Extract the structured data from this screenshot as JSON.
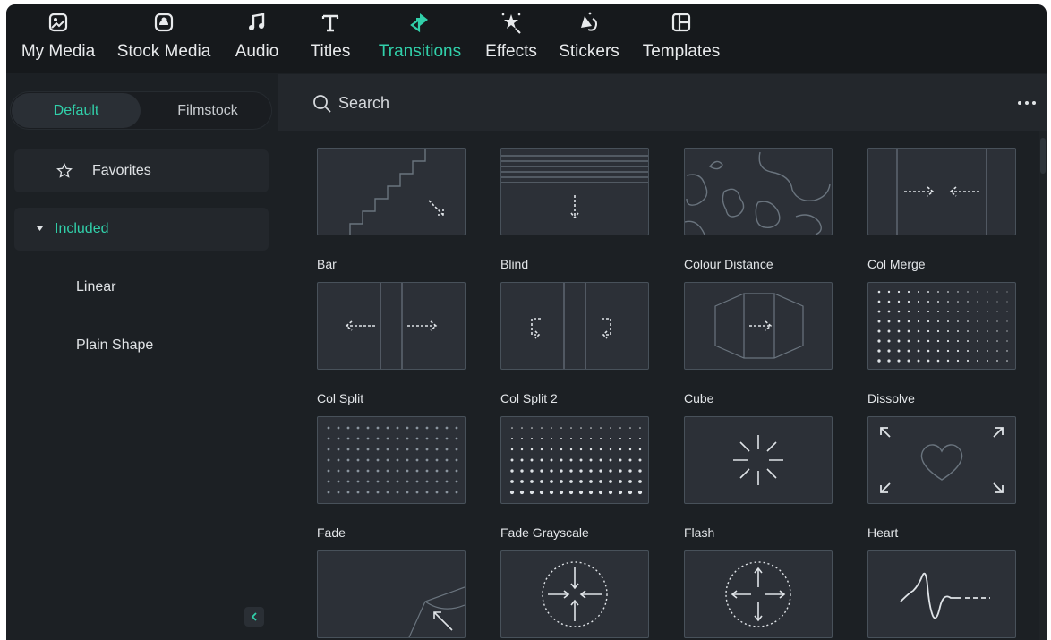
{
  "toolbar": {
    "tabs": [
      {
        "label": "My Media",
        "icon": "my-media-icon"
      },
      {
        "label": "Stock Media",
        "icon": "stock-media-icon"
      },
      {
        "label": "Audio",
        "icon": "music-note-icon"
      },
      {
        "label": "Titles",
        "icon": "title-t-icon"
      },
      {
        "label": "Transitions",
        "icon": "transitions-icon",
        "active": true
      },
      {
        "label": "Effects",
        "icon": "effects-wand-icon"
      },
      {
        "label": "Stickers",
        "icon": "stickers-icon"
      },
      {
        "label": "Templates",
        "icon": "templates-icon"
      }
    ]
  },
  "sidebar": {
    "segments": {
      "default": "Default",
      "filmstock": "Filmstock"
    },
    "favorites": "Favorites",
    "included": "Included",
    "subitems": [
      "Linear",
      "Plain Shape"
    ]
  },
  "search": {
    "placeholder": "Search"
  },
  "transitions": [
    {
      "label": "Bar",
      "thumb": "bar"
    },
    {
      "label": "Blind",
      "thumb": "blind"
    },
    {
      "label": "Colour Distance",
      "thumb": "colour-distance"
    },
    {
      "label": "Col Merge",
      "thumb": "col-merge"
    },
    {
      "label": "Col Split",
      "thumb": "col-split"
    },
    {
      "label": "Col Split 2",
      "thumb": "col-split-2"
    },
    {
      "label": "Cube",
      "thumb": "cube"
    },
    {
      "label": "Dissolve",
      "thumb": "dissolve"
    },
    {
      "label": "Fade",
      "thumb": "fade"
    },
    {
      "label": "Fade Grayscale",
      "thumb": "fade-grayscale"
    },
    {
      "label": "Flash",
      "thumb": "flash"
    },
    {
      "label": "Heart",
      "thumb": "heart"
    },
    {
      "label": "",
      "thumb": "page-curl"
    },
    {
      "label": "",
      "thumb": "circle-in"
    },
    {
      "label": "",
      "thumb": "circle-out"
    },
    {
      "label": "",
      "thumb": "wave"
    }
  ],
  "colors": {
    "accent": "#31d0aa",
    "background": "#1c2024",
    "toolbar": "#16191c",
    "thumb_bg": "#2c3037"
  }
}
